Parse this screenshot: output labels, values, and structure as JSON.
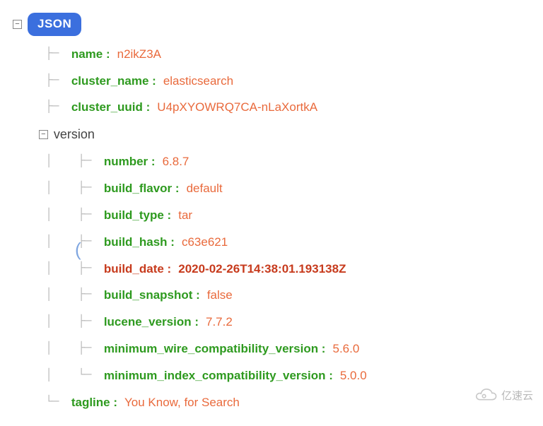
{
  "root_label": "JSON",
  "fields": {
    "name": {
      "key": "name :",
      "val": "n2ikZ3A"
    },
    "cluster_name": {
      "key": "cluster_name :",
      "val": "elasticsearch"
    },
    "cluster_uuid": {
      "key": "cluster_uuid :",
      "val": "U4pXYOWRQ7CA-nLaXortkA"
    },
    "version_label": "version",
    "version": {
      "number": {
        "key": "number :",
        "val": "6.8.7"
      },
      "build_flavor": {
        "key": "build_flavor :",
        "val": "default"
      },
      "build_type": {
        "key": "build_type :",
        "val": "tar"
      },
      "build_hash": {
        "key": "build_hash :",
        "val": "c63e621"
      },
      "build_date": {
        "key": "build_date :",
        "val": "2020-02-26T14:38:01.193138Z"
      },
      "build_snapshot": {
        "key": "build_snapshot :",
        "val": "false"
      },
      "lucene_version": {
        "key": "lucene_version :",
        "val": "7.7.2"
      },
      "min_wire": {
        "key": "minimum_wire_compatibility_version :",
        "val": "5.6.0"
      },
      "min_index": {
        "key": "minimum_index_compatibility_version :",
        "val": "5.0.0"
      }
    },
    "tagline": {
      "key": "tagline :",
      "val": "You Know, for Search"
    }
  },
  "watermark": "亿速云"
}
